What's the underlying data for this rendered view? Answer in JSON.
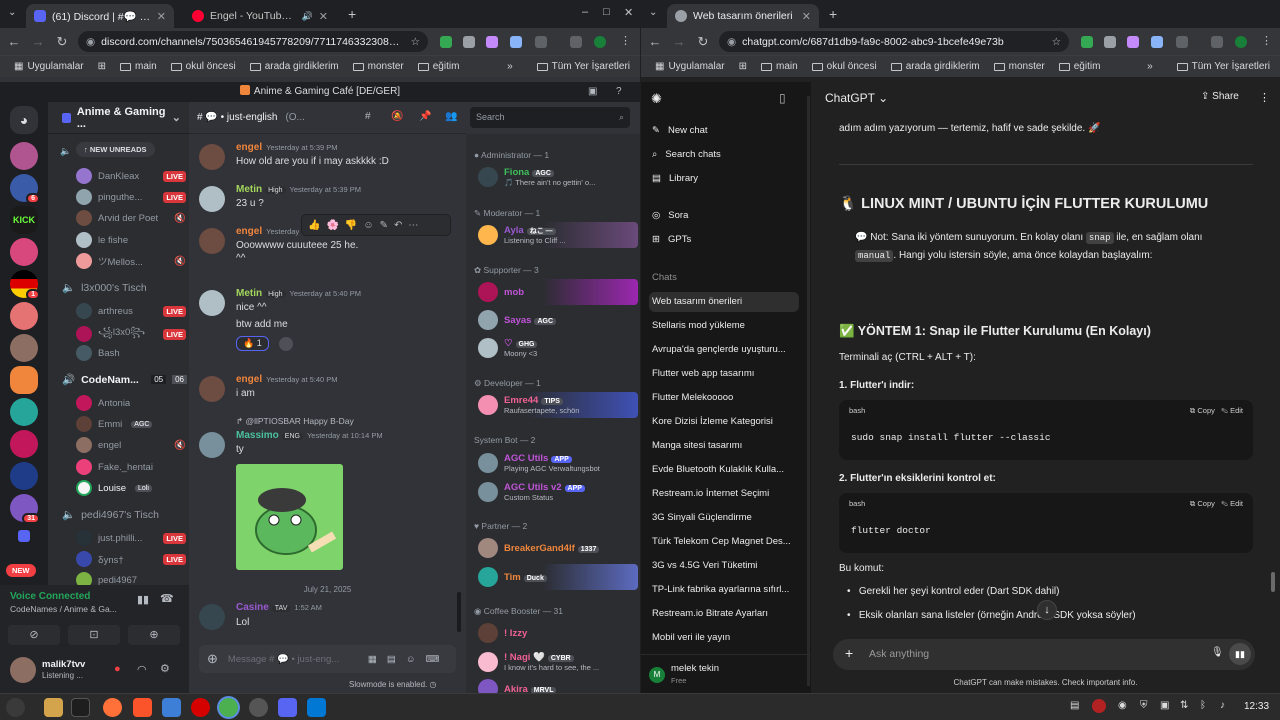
{
  "left_browser": {
    "tabs": [
      {
        "label": "(61) Discord | #💬 • just-english",
        "active": true
      },
      {
        "label": "Engel - YouTube Music",
        "active": false
      }
    ],
    "url": "discord.com/channels/750365461945778209/771174633230827540",
    "bookmarks": [
      "Uygulamalar",
      "main",
      "okul öncesi",
      "arada girdiklerim",
      "monster",
      "eğitim"
    ],
    "bookmarks_right": "Tüm Yer İşaretleri"
  },
  "discord": {
    "window_title": "Anime & Gaming Café [DE/GER]",
    "server_name": "Anime & Gaming ...",
    "new_unreads": "NEW UNREADS",
    "guild_badges": [
      "6",
      "1",
      "31"
    ],
    "guild_new": "NEW",
    "voice_groups": [
      {
        "users": [
          {
            "name": "DanKleax",
            "live": "LIVE"
          },
          {
            "name": "pinguthe...",
            "live": "LIVE"
          },
          {
            "name": "Arvid der Poet",
            "live": ""
          },
          {
            "name": "le fishe",
            "live": ""
          },
          {
            "name": "ツMellos...",
            "live": ""
          }
        ]
      },
      {
        "title": "l3x000's Tisch",
        "users": [
          {
            "name": "arthreus",
            "live": "LIVE"
          },
          {
            "name": "꧁l3x0꧂",
            "live": "LIVE"
          },
          {
            "name": "Bash",
            "live": ""
          }
        ]
      },
      {
        "title": "CodeNam...",
        "counts": [
          "05",
          "06"
        ],
        "users": [
          {
            "name": "Antonia",
            "live": ""
          },
          {
            "name": "Emmi",
            "tag": "AGC",
            "live": ""
          },
          {
            "name": "engel",
            "live": ""
          },
          {
            "name": "Fake._hentai",
            "live": ""
          },
          {
            "name": "Louise",
            "tag": "Loli",
            "live": ""
          }
        ]
      },
      {
        "title": "pedi4967's Tisch",
        "users": [
          {
            "name": "just.philli...",
            "live": "LIVE"
          },
          {
            "name": "Ᵹyns†",
            "live": "LIVE"
          },
          {
            "name": "pedi4967",
            "live": ""
          }
        ]
      }
    ],
    "voice_status": {
      "title": "Voice Connected",
      "sub": "CodeNames / Anime & Ga..."
    },
    "self_user": {
      "name": "malik7tvv",
      "status": "Listening ..."
    },
    "channel": {
      "name": "# 💬 • just-english",
      "extra": "(O..."
    },
    "search_placeholder": "Search",
    "messages": [
      {
        "author": "engel",
        "time": "Yesterday at 5:39 PM",
        "text": "How old are you if i may askkkk :D",
        "color": "#f0863c"
      },
      {
        "author": "Metin",
        "badge": "High",
        "time": "Yesterday at 5:39 PM",
        "text": "23 u ?",
        "color": "#a3d65b"
      },
      {
        "author": "engel",
        "time": "Yesterday a...",
        "text": "Ooowwww cuuuteee 25 he.",
        "text2": "^^",
        "color": "#f0863c"
      },
      {
        "author": "Metin",
        "badge": "High",
        "time": "Yesterday at 5:40 PM",
        "text": "nice ^^",
        "text2": "btw add me",
        "reaction": "🔥 1",
        "color": "#a3d65b"
      },
      {
        "author": "engel",
        "time": "Yesterday at 5:40 PM",
        "text": "i am",
        "color": "#f0863c"
      },
      {
        "author": "Massimo",
        "badge": "ENG",
        "reply": "@llPTIOSBAR Happy B-Day",
        "time": "Yesterday at 10:14 PM",
        "text": "ty",
        "color": "#4bc0a0"
      },
      {
        "author": "Casine",
        "badge": "TAV",
        "time": "1:52 AM",
        "text": "Lol",
        "color": "#9b59d0"
      }
    ],
    "date_divider": "July 21, 2025",
    "composer_placeholder": "Message # 💬 • just-eng...",
    "slowmode": "Slowmode is enabled.",
    "member_groups": [
      {
        "title": "Administrator — 1",
        "members": [
          {
            "name": "Fiona",
            "tag": "AGC",
            "status": "🎵 There ain't no gettin' o...",
            "color": "#3fbf5a"
          }
        ]
      },
      {
        "title": "Moderator — 1",
        "members": [
          {
            "name": "Ayla",
            "tag": "ねこ —",
            "status": "Listening to Cliff ...",
            "color": "#9b59d0"
          }
        ]
      },
      {
        "title": "Supporter — 3",
        "members": [
          {
            "name": "mob",
            "tag": "",
            "status": "",
            "color": "#c054d8"
          },
          {
            "name": "Sayas",
            "tag": "AGC",
            "status": "",
            "color": "#c054d8"
          },
          {
            "name": "Moony",
            "tag": "GHG",
            "status": "Moony <3",
            "color": "#c054d8"
          }
        ]
      },
      {
        "title": "Developer — 1",
        "members": [
          {
            "name": "Emre44",
            "tag": "TIPS",
            "status": "Raufasertapete, schön",
            "color": "#f06292"
          }
        ]
      },
      {
        "title": "System Bot — 2",
        "members": [
          {
            "name": "AGC Utils",
            "tag": "APP",
            "status": "Playing AGC Verwaltungsbot",
            "color": "#c054d8"
          },
          {
            "name": "AGC Utils v2",
            "tag": "APP",
            "status": "Custom Status",
            "color": "#c054d8"
          }
        ]
      },
      {
        "title": "Partner — 2",
        "members": [
          {
            "name": "BreakerGand4lf",
            "tag": "1337",
            "status": "",
            "color": "#f0863c"
          },
          {
            "name": "Tim",
            "tag": "Duck",
            "status": "",
            "color": "#f0863c"
          }
        ]
      },
      {
        "title": "Coffee Booster — 31",
        "members": [
          {
            "name": "! Izzy",
            "tag": "",
            "status": "",
            "color": "#f06292"
          },
          {
            "name": "! Nagi 🤍",
            "tag": "CYBR",
            "status": "I know it's hard to see, the ...",
            "color": "#f06292"
          },
          {
            "name": "Akira",
            "tag": "MRVL",
            "status": "",
            "color": "#f06292"
          }
        ]
      }
    ]
  },
  "right_browser": {
    "tabs": [
      {
        "label": "Web tasarım önerileri",
        "active": true
      }
    ],
    "url": "chatgpt.com/c/687d1db9-fa9c-8002-abc9-1bcefe49e73b",
    "bookmarks": [
      "Uygulamalar",
      "main",
      "okul öncesi",
      "arada girdiklerim",
      "monster",
      "eğitim"
    ],
    "bookmarks_right": "Tüm Yer İşaretleri"
  },
  "chatgpt": {
    "model": "ChatGPT",
    "share": "Share",
    "nav": [
      "New chat",
      "Search chats",
      "Library"
    ],
    "gpts": [
      "Sora",
      "GPTs"
    ],
    "chats_label": "Chats",
    "history": [
      "Web tasarım önerileri",
      "Stellaris mod yükleme",
      "Avrupa'da gençlerde uyuşturu...",
      "Flutter web app tasarımı",
      "Flutter Melekooooo",
      "Kore Dizisi İzleme Kategorisi",
      "Manga sitesi tasarımı",
      "Evde Bluetooth Kulaklık Kulla...",
      "Restream.io İnternet Seçimi",
      "3G Sinyali Güçlendirme",
      "Türk Telekom Cep Magnet Des...",
      "3G vs 4.5G Veri Tüketimi",
      "TP-Link fabrika ayarlarına sıfırl...",
      "Restream.io Bitrate Ayarları",
      "Mobil veri ile yayın"
    ],
    "user": {
      "name": "melek tekin",
      "plan": "Free",
      "initial": "M"
    },
    "content": {
      "intro": "adım adım yazıyorum — tertemiz, hafif ve sade şekilde. 🚀",
      "heading": "🐧 LINUX MINT / UBUNTU İÇİN FLUTTER KURULUMU",
      "note_prefix": "💬 Not: Sana iki yöntem sunuyorum. En kolay olanı ",
      "note_code1": "snap",
      "note_mid": " ile, en sağlam olanı",
      "note_code2": "manual",
      "note_end": ". Hangi yolu istersin söyle, ama önce kolaydan başlayalım:",
      "method": "✅ YÖNTEM 1: Snap ile Flutter Kurulumu (En Kolayı)",
      "terminal": "Terminali aç (CTRL + ALT + T):",
      "step1": "1. Flutter'ı indir:",
      "code1": "sudo snap install flutter --classic",
      "step2": "2. Flutter'ın eksiklerini kontrol et:",
      "code2": "flutter doctor",
      "code_lang": "bash",
      "copy": "Copy",
      "edit": "Edit",
      "bu_komut": "Bu komut:",
      "bullets": [
        "Gerekli her şeyi kontrol eder (Dart SDK dahil)",
        "Eksik olanları sana listeler (örneğin Android SDK yoksa söyler)"
      ]
    },
    "input_placeholder": "Ask anything",
    "disclaimer": "ChatGPT can make mistakes. Check important info."
  },
  "taskbar": {
    "clock": "12:33"
  }
}
